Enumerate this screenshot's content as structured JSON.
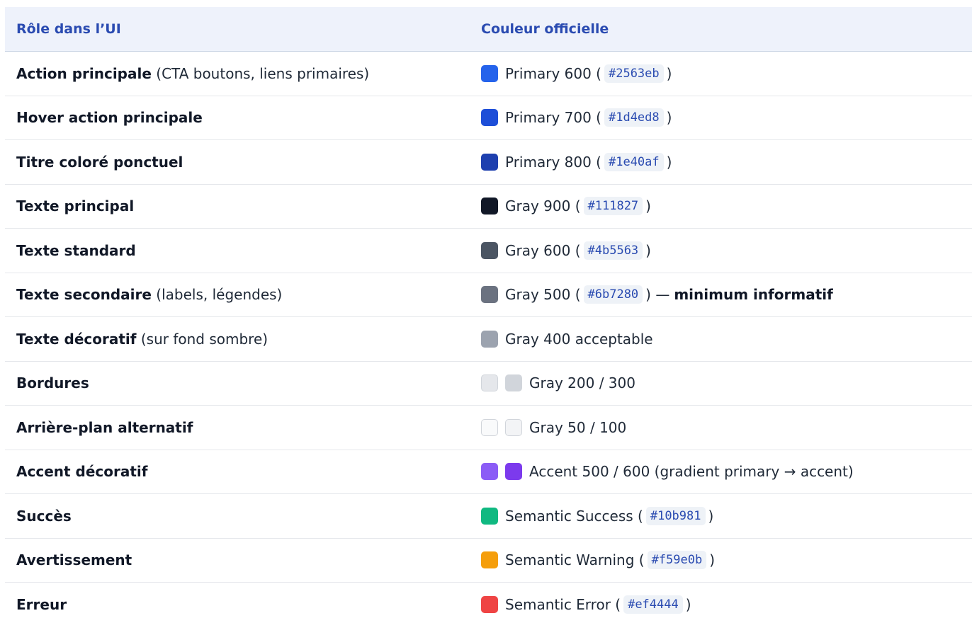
{
  "header": {
    "col_role": "Rôle dans l’UI",
    "col_color": "Couleur officielle"
  },
  "rows": [
    {
      "role": "Action principale",
      "role_note": "(CTA boutons, liens primaires)",
      "swatches": [
        "#2563eb"
      ],
      "label": "Primary 600 (",
      "code": "#2563eb",
      "after": ")",
      "extra": ""
    },
    {
      "role": "Hover action principale",
      "role_note": "",
      "swatches": [
        "#1d4ed8"
      ],
      "label": "Primary 700 (",
      "code": "#1d4ed8",
      "after": ")",
      "extra": ""
    },
    {
      "role": "Titre coloré ponctuel",
      "role_note": "",
      "swatches": [
        "#1e40af"
      ],
      "label": "Primary 800 (",
      "code": "#1e40af",
      "after": ")",
      "extra": ""
    },
    {
      "role": "Texte principal",
      "role_note": "",
      "swatches": [
        "#111827"
      ],
      "label": "Gray 900 (",
      "code": "#111827",
      "after": ")",
      "extra": ""
    },
    {
      "role": "Texte standard",
      "role_note": "",
      "swatches": [
        "#4b5563"
      ],
      "label": "Gray 600 (",
      "code": "#4b5563",
      "after": ")",
      "extra": ""
    },
    {
      "role": "Texte secondaire",
      "role_note": "(labels, légendes)",
      "swatches": [
        "#6b7280"
      ],
      "label": "Gray 500 (",
      "code": "#6b7280",
      "after": ") —",
      "extra": "minimum informatif"
    },
    {
      "role": "Texte décoratif",
      "role_note": "(sur fond sombre)",
      "swatches": [
        "#9ca3af"
      ],
      "label": "Gray 400 acceptable",
      "code": "",
      "after": "",
      "extra": ""
    },
    {
      "role": "Bordures",
      "role_note": "",
      "swatches": [
        "#e5e7eb",
        "#d1d5db"
      ],
      "label": "Gray 200 / 300",
      "code": "",
      "after": "",
      "extra": ""
    },
    {
      "role": "Arrière-plan alternatif",
      "role_note": "",
      "swatches": [
        "#f9fafb",
        "#f3f4f6"
      ],
      "label": "Gray 50 / 100",
      "code": "",
      "after": "",
      "extra": ""
    },
    {
      "role": "Accent décoratif",
      "role_note": "",
      "swatches": [
        "#8b5cf6",
        "#7c3aed"
      ],
      "label": "Accent 500 / 600 (gradient primary → accent)",
      "code": "",
      "after": "",
      "extra": ""
    },
    {
      "role": "Succès",
      "role_note": "",
      "swatches": [
        "#10b981"
      ],
      "label": "Semantic Success (",
      "code": "#10b981",
      "after": ")",
      "extra": ""
    },
    {
      "role": "Avertissement",
      "role_note": "",
      "swatches": [
        "#f59e0b"
      ],
      "label": "Semantic Warning (",
      "code": "#f59e0b",
      "after": ")",
      "extra": ""
    },
    {
      "role": "Erreur",
      "role_note": "",
      "swatches": [
        "#ef4444"
      ],
      "label": "Semantic Error (",
      "code": "#ef4444",
      "after": ")",
      "extra": ""
    }
  ]
}
